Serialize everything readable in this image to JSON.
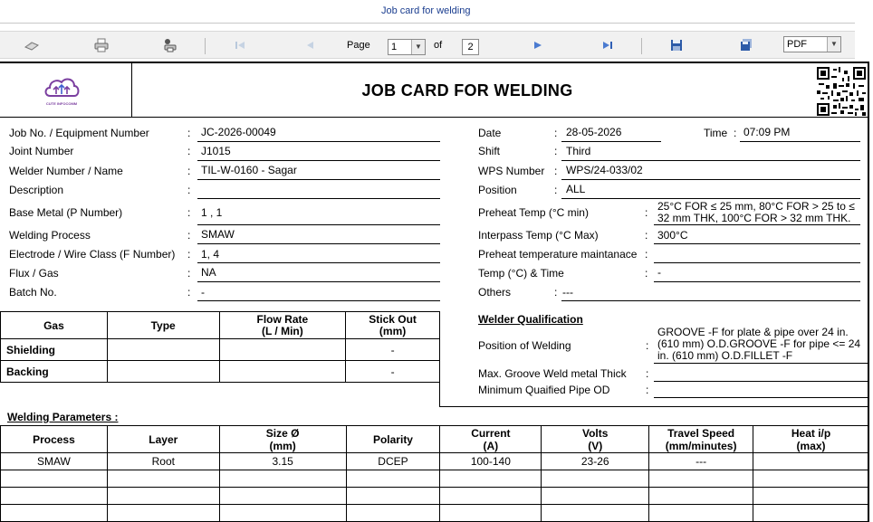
{
  "window": {
    "tab_title": "Job card for welding"
  },
  "toolbar": {
    "page_label": "Page",
    "current_page": "1",
    "of_label": "of",
    "total_pages": "2",
    "export_format": "PDF",
    "icons": [
      "scan-icon",
      "print-icon",
      "print-settings-icon",
      "first-page-icon",
      "previous-page-icon",
      "next-page-icon",
      "last-page-icon",
      "save-icon",
      "export-save-icon"
    ]
  },
  "document": {
    "title": "JOB CARD FOR WELDING",
    "logo_text": "CUTE INFOCOMM",
    "left_fields": [
      {
        "label": "Job No. / Equipment Number",
        "value": "JC-2026-00049"
      },
      {
        "label": "Joint Number",
        "value": "J1015"
      },
      {
        "label": "Welder Number / Name",
        "value": "TIL-W-0160 - Sagar"
      },
      {
        "label": "Description",
        "value": ""
      },
      {
        "label": "Base Metal (P Number)",
        "value": "1 , 1"
      },
      {
        "label": "Welding Process",
        "value": "SMAW"
      },
      {
        "label": "Electrode / Wire Class (F Number)",
        "value": "1, 4"
      },
      {
        "label": "Flux / Gas",
        "value": "NA"
      },
      {
        "label": "Batch No.",
        "value": "-"
      }
    ],
    "date": {
      "label": "Date",
      "value": "28-05-2026"
    },
    "time": {
      "label": "Time",
      "value": "07:09 PM"
    },
    "right_fields": [
      {
        "label": "Shift",
        "value": "Third"
      },
      {
        "label": "WPS Number",
        "value": "WPS/24-033/02"
      },
      {
        "label": "Position",
        "value": "ALL"
      },
      {
        "label": "Preheat Temp (°C min)",
        "value": "25°C FOR ≤ 25 mm, 80°C FOR > 25 to ≤ 32 mm THK, 100°C FOR > 32 mm THK."
      },
      {
        "label": "Interpass Temp (°C Max)",
        "value": "300°C"
      },
      {
        "label": "Preheat temperature maintanace",
        "value": ""
      },
      {
        "label": "Temp (°C) & Time",
        "value": "-"
      },
      {
        "label": "Others",
        "value": "---"
      }
    ],
    "gas_table": {
      "headers": [
        "Gas",
        "Type",
        "Flow Rate\n(L / Min)",
        "Stick Out\n(mm)"
      ],
      "rows": [
        {
          "name": "Shielding",
          "type": "",
          "flow": "",
          "stick_out": "-"
        },
        {
          "name": "Backing",
          "type": "",
          "flow": "",
          "stick_out": "-"
        }
      ]
    },
    "welder_qualification": {
      "heading": "Welder Qualification",
      "position_label": "Position of Welding",
      "position_value": "GROOVE -F for plate & pipe over 24 in.(610 mm) O.D.GROOVE -F for pipe <= 24 in. (610 mm) O.D.FILLET -F",
      "max_groove_label": "Max. Groove Weld metal Thick",
      "max_groove_value": "",
      "min_pipe_label": "Minimum Quaified Pipe OD",
      "min_pipe_value": ""
    },
    "welding_parameters": {
      "heading": "Welding Parameters :",
      "headers": [
        "Process",
        "Layer",
        "Size Ø\n(mm)",
        "Polarity",
        "Current\n(A)",
        "Volts\n(V)",
        "Travel Speed\n(mm/minutes)",
        "Heat i/p\n(max)"
      ],
      "rows": [
        [
          "SMAW",
          "Root",
          "3.15",
          "DCEP",
          "100-140",
          "23-26",
          "---",
          ""
        ],
        [
          "",
          "",
          "",
          "",
          "",
          "",
          "",
          ""
        ],
        [
          "",
          "",
          "",
          "",
          "",
          "",
          "",
          ""
        ],
        [
          "",
          "",
          "",
          "",
          "",
          "",
          "",
          ""
        ]
      ]
    }
  }
}
